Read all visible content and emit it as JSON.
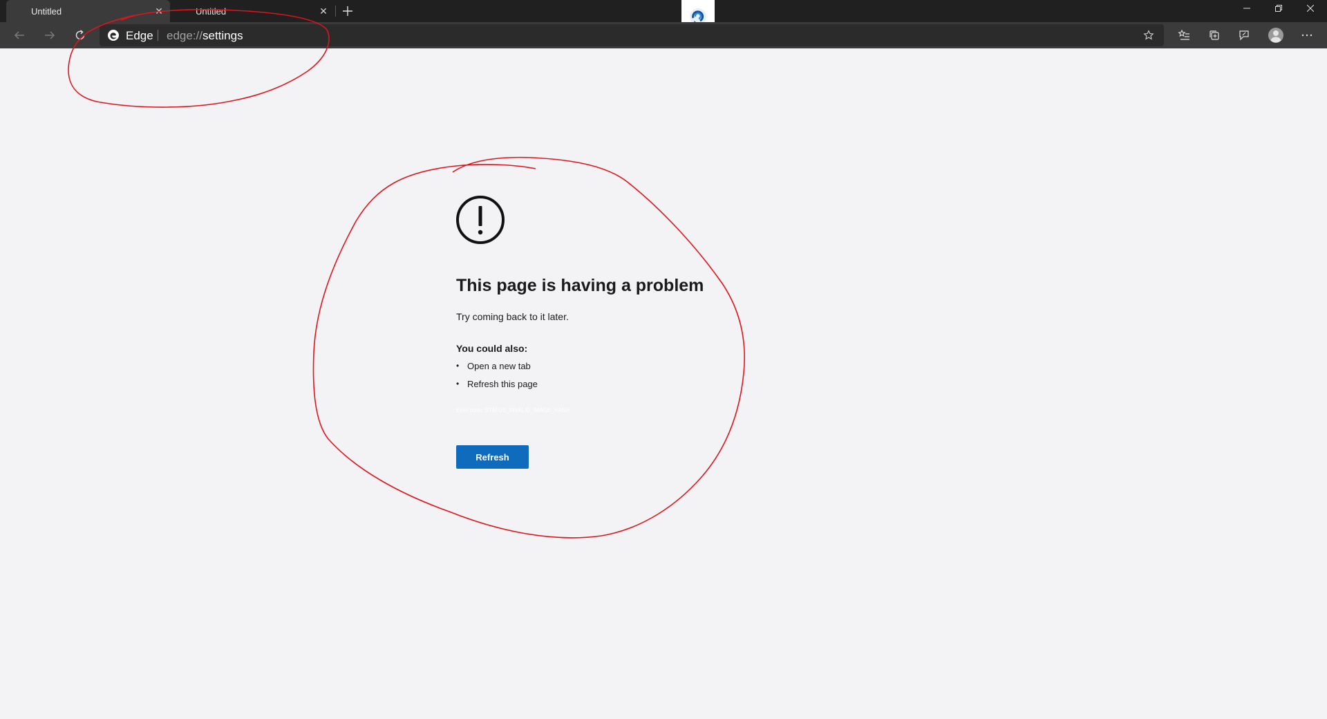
{
  "tabs": [
    {
      "title": "Untitled",
      "active": true
    },
    {
      "title": "Untitled",
      "active": false
    }
  ],
  "toolbar": {
    "back_icon": "arrow-left-icon",
    "forward_icon": "arrow-right-icon",
    "refresh_icon": "refresh-icon"
  },
  "omnibox": {
    "brand": "Edge",
    "url_scheme": "edge://",
    "url_path": "settings"
  },
  "error": {
    "title": "This page is having a problem",
    "subtitle": "Try coming back to it later.",
    "also_heading": "You could also:",
    "suggestions": [
      "Open a new tab",
      "Refresh this page"
    ],
    "code": "Error code: STATUS_INVALID_IMAGE_HASH",
    "refresh_label": "Refresh"
  },
  "colors": {
    "accent": "#0f6cbd",
    "annotation": "#e0141c",
    "page_background": "#f3f3f5"
  }
}
